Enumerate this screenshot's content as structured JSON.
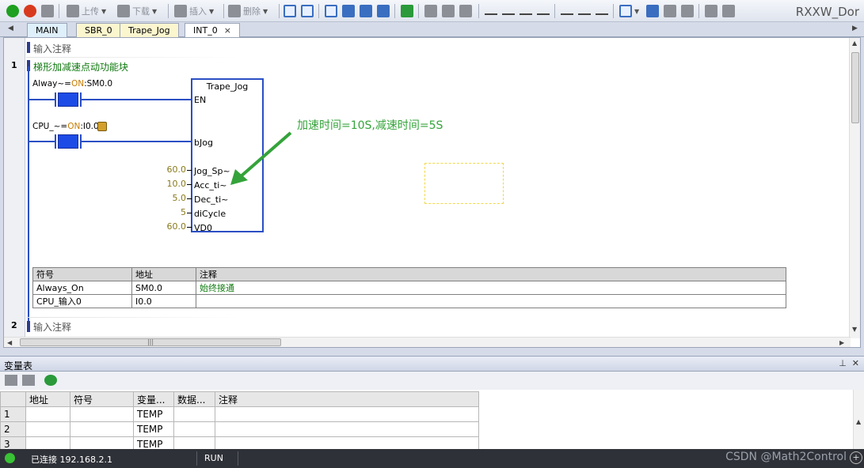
{
  "toolbar": {
    "upload_label": "上传",
    "download_label": "下载",
    "insert_label": "插入",
    "delete_label": "删除",
    "brand": "RXXW_Dor"
  },
  "tabs": [
    {
      "label": "MAIN"
    },
    {
      "label": "SBR_0"
    },
    {
      "label": "Trape_Jog"
    },
    {
      "label": "INT_0",
      "close": "×"
    }
  ],
  "editor": {
    "network1": {
      "number": "1",
      "comment_placeholder": "输入注释",
      "title": "梯形加减速点动功能块",
      "contact1": {
        "sym": "Alway~",
        "eq": "=",
        "on": "ON",
        "addr": ":SM0.0"
      },
      "contact2": {
        "sym": "CPU_~",
        "eq": "=",
        "on": "ON",
        "addr": ":I0.0"
      },
      "block": {
        "name": "Trape_Jog",
        "pins": [
          {
            "name": "EN",
            "value": ""
          },
          {
            "name": "bJog",
            "value": ""
          },
          {
            "name": "Jog_Sp~",
            "value": "60.0"
          },
          {
            "name": "Acc_ti~",
            "value": "10.0"
          },
          {
            "name": "Dec_ti~",
            "value": "5.0"
          },
          {
            "name": "diCycle",
            "value": "5"
          },
          {
            "name": "VD0",
            "value": "60.0"
          }
        ]
      },
      "annotation": "加速时间=10S,减速时间=5S"
    },
    "symbol_table": {
      "headers": [
        "符号",
        "地址",
        "注释"
      ],
      "rows": [
        [
          "Always_On",
          "SM0.0",
          "始终接通"
        ],
        [
          "CPU_输入0",
          "I0.0",
          ""
        ]
      ]
    },
    "network2": {
      "number": "2",
      "comment_placeholder": "输入注释"
    }
  },
  "var_table": {
    "title": "变量表",
    "headers": [
      "",
      "地址",
      "符号",
      "变量...",
      "数据...",
      "注释"
    ],
    "rows": [
      [
        "1",
        "",
        "",
        "TEMP",
        "",
        ""
      ],
      [
        "2",
        "",
        "",
        "TEMP",
        "",
        ""
      ],
      [
        "3",
        "",
        "",
        "TEMP",
        "",
        ""
      ]
    ]
  },
  "status": {
    "connection": "已连接 192.168.2.1",
    "mode": "RUN",
    "watermark": "CSDN @Math2Control"
  },
  "colors": {
    "accent_blue": "#2b4fc4",
    "comment_green": "#107a10",
    "annotation_green": "#34a33a",
    "status_led": "#39c235"
  }
}
